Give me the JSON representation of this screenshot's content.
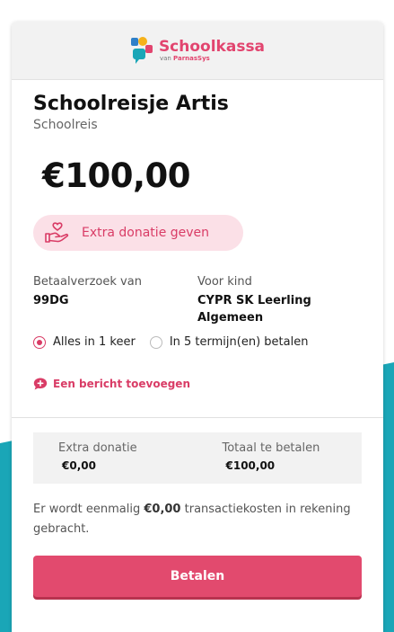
{
  "brand": {
    "name": "Schoolkassa",
    "sub_prefix": "van",
    "sub_brand": "ParnasSys",
    "accent": "#e2456f",
    "teal": "#1aa6b7"
  },
  "request": {
    "title": "Schoolreisje Artis",
    "subtitle": "Schoolreis",
    "amount": "€100,00"
  },
  "donation_button": {
    "label": "Extra donatie geven",
    "icon": "hand-heart-icon"
  },
  "info": {
    "requester_label": "Betaalverzoek van",
    "requester_value": "99DG",
    "child_label": "Voor kind",
    "child_value": "CYPR SK Leerling Algemeen"
  },
  "payment_options": [
    {
      "label": "Alles in 1 keer",
      "selected": true
    },
    {
      "label": "In 5 termijn(en) betalen",
      "selected": false
    }
  ],
  "message_link": {
    "label": "Een bericht toevoegen",
    "icon": "chat-plus-icon"
  },
  "summary": {
    "donation_label": "Extra donatie",
    "donation_value": "€0,00",
    "total_label": "Totaal te betalen",
    "total_value": "€100,00"
  },
  "fee": {
    "pre": "Er wordt eenmalig",
    "amount": "€0,00",
    "post": "transactiekosten in rekening gebracht."
  },
  "pay_button": {
    "label": "Betalen"
  }
}
